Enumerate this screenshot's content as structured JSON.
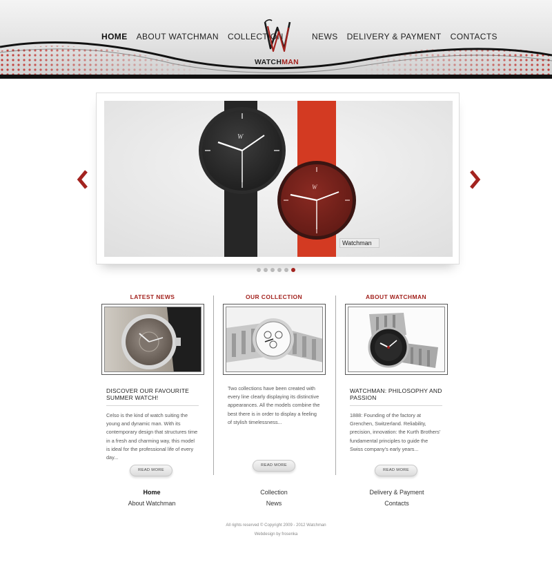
{
  "colors": {
    "accent": "#a3231f",
    "text": "#333333",
    "muted": "#888888"
  },
  "nav": {
    "left": [
      "Home",
      "About Watchman",
      "Collection"
    ],
    "right": [
      "News",
      "Delivery & Payment",
      "Contacts"
    ],
    "active": "Home"
  },
  "logo": {
    "word_black": "WATCH",
    "word_red": "MAN"
  },
  "slider": {
    "slide_caption": "Watchman",
    "dot_count": 6,
    "active_dot": 6,
    "prev_icon": "chevron-left-icon",
    "next_icon": "chevron-right-icon"
  },
  "columns": [
    {
      "title": "LATEST NEWS",
      "heading": "DISCOVER OUR FAVOURITE SUMMER WATCH!",
      "text": "Celso is the kind of watch suiting the young and dynamic man. With its contemporary design that structures time in a fresh and charming way, this model is ideal for the professional life of every day...",
      "button": "READ MORE"
    },
    {
      "title": "OUR COLLECTION",
      "heading": "",
      "text": "Two collections have been created with every line clearly displaying its distinctive appearances. All the models combine the best there is in order to display a feeling of stylish timelessness...",
      "button": "READ MORE"
    },
    {
      "title": "ABOUT WATCHMAN",
      "heading": "WATCHMAN: PHILOSOPHY AND PASSION",
      "text": "1888: Founding of the factory at Grenchen, Switzerland. Reliability, precision, innovation: the Kurth Brothers' fundamental principles to guide the Swiss company's early years...",
      "button": "READ MORE"
    }
  ],
  "footer": {
    "col1": [
      "Home",
      "About Watchman"
    ],
    "col2": [
      "Collection",
      "News"
    ],
    "col3": [
      "Delivery & Payment",
      "Contacts"
    ],
    "copyright": "All rights reserved © Copyright 2009 - 2012 Watchman",
    "credit": "Webdesign by frosenka"
  }
}
